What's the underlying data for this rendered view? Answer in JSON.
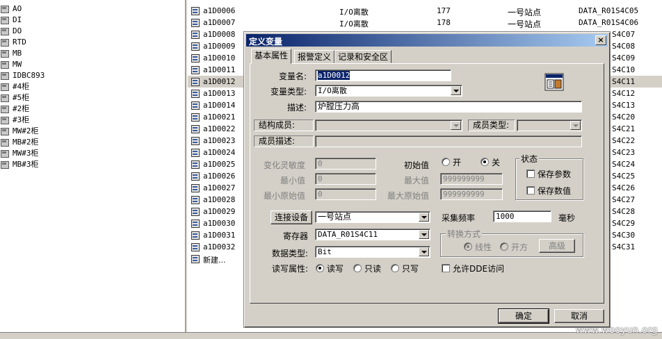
{
  "left_tree": {
    "items": [
      {
        "label": "AO"
      },
      {
        "label": "DI"
      },
      {
        "label": "DO"
      },
      {
        "label": "RTD"
      },
      {
        "label": "MB"
      },
      {
        "label": "MW"
      },
      {
        "label": "IDBC893"
      },
      {
        "label": "#4柜"
      },
      {
        "label": "#5柜"
      },
      {
        "label": "#2柜"
      },
      {
        "label": "#3柜"
      },
      {
        "label": "MW#2柜"
      },
      {
        "label": "MB#2柜"
      },
      {
        "label": "MW#3柜"
      },
      {
        "label": "MB#3柜"
      }
    ]
  },
  "var_list": {
    "rows": [
      {
        "name": "a1D0006",
        "type": "I/O离散",
        "id": "177",
        "station": "一号站点",
        "reg": "DATA_R01S4C05",
        "reg_tail": ""
      },
      {
        "name": "a1D0007",
        "type": "I/O离散",
        "id": "178",
        "station": "一号站点",
        "reg": "DATA_R01S4C06",
        "reg_tail": ""
      },
      {
        "name": "a1D0008",
        "type": "",
        "id": "",
        "station": "",
        "reg": "",
        "reg_tail": "S4C07"
      },
      {
        "name": "a1D0009",
        "type": "",
        "id": "",
        "station": "",
        "reg": "",
        "reg_tail": "S4C08"
      },
      {
        "name": "a1D0010",
        "type": "",
        "id": "",
        "station": "",
        "reg": "",
        "reg_tail": "S4C09"
      },
      {
        "name": "a1D0011",
        "type": "",
        "id": "",
        "station": "",
        "reg": "",
        "reg_tail": "S4C10"
      },
      {
        "name": "a1D0012",
        "type": "",
        "id": "",
        "station": "",
        "reg": "",
        "reg_tail": "S4C11"
      },
      {
        "name": "a1D0013",
        "type": "",
        "id": "",
        "station": "",
        "reg": "",
        "reg_tail": "S4C12"
      },
      {
        "name": "a1D0014",
        "type": "",
        "id": "",
        "station": "",
        "reg": "",
        "reg_tail": "S4C13"
      },
      {
        "name": "a1D0021",
        "type": "",
        "id": "",
        "station": "",
        "reg": "",
        "reg_tail": "S4C20"
      },
      {
        "name": "a1D0022",
        "type": "",
        "id": "",
        "station": "",
        "reg": "",
        "reg_tail": "S4C21"
      },
      {
        "name": "a1D0023",
        "type": "",
        "id": "",
        "station": "",
        "reg": "",
        "reg_tail": "S4C22"
      },
      {
        "name": "a1D0024",
        "type": "",
        "id": "",
        "station": "",
        "reg": "",
        "reg_tail": "S4C23"
      },
      {
        "name": "a1D0025",
        "type": "",
        "id": "",
        "station": "",
        "reg": "",
        "reg_tail": "S4C24"
      },
      {
        "name": "a1D0026",
        "type": "",
        "id": "",
        "station": "",
        "reg": "",
        "reg_tail": "S4C25"
      },
      {
        "name": "a1D0027",
        "type": "",
        "id": "",
        "station": "",
        "reg": "",
        "reg_tail": "S4C26"
      },
      {
        "name": "a1D0028",
        "type": "",
        "id": "",
        "station": "",
        "reg": "",
        "reg_tail": "S4C27"
      },
      {
        "name": "a1D0029",
        "type": "",
        "id": "",
        "station": "",
        "reg": "",
        "reg_tail": "S4C28"
      },
      {
        "name": "a1D0030",
        "type": "",
        "id": "",
        "station": "",
        "reg": "",
        "reg_tail": "S4C29"
      },
      {
        "name": "a1D0031",
        "type": "",
        "id": "",
        "station": "",
        "reg": "",
        "reg_tail": "S4C30"
      },
      {
        "name": "a1D0032",
        "type": "",
        "id": "",
        "station": "",
        "reg": "",
        "reg_tail": "S4C31"
      }
    ],
    "new_item": "新建..."
  },
  "dialog": {
    "title": "定义变量",
    "close_glyph": "×",
    "tabs": [
      {
        "label": "基本属性"
      },
      {
        "label": "报警定义"
      },
      {
        "label": "记录和安全区"
      }
    ],
    "var_name": {
      "label": "变量名:",
      "value": "a1D0012"
    },
    "var_type": {
      "label": "变量类型:",
      "value": "I/O离散"
    },
    "description": {
      "label": "描述:",
      "value": "炉膛压力高"
    },
    "struct_member": {
      "label": "结构成员:",
      "value": ""
    },
    "member_type": {
      "label": "成员类型:",
      "value": ""
    },
    "member_desc": {
      "label": "成员描述:",
      "value": ""
    },
    "sensitivity": {
      "label": "变化灵敏度",
      "value": "0"
    },
    "min_value": {
      "label": "最小值",
      "value": "0"
    },
    "min_raw": {
      "label": "最小原始值",
      "value": "0"
    },
    "max_value": {
      "label": "最大值",
      "value": "999999999"
    },
    "max_raw": {
      "label": "最大原始值",
      "value": "999999999"
    },
    "initial": {
      "label": "初始值",
      "on_label": "开",
      "off_label": "关",
      "selected": "off"
    },
    "status_group": {
      "title": "状态",
      "save_params": "保存参数",
      "save_values": "保存数值"
    },
    "device_button": "连接设备",
    "device": {
      "value": "一号站点"
    },
    "frequency": {
      "label": "采集频率",
      "value": "1000",
      "unit": "毫秒"
    },
    "register": {
      "label": "寄存器",
      "value": "DATA_R01S4C11"
    },
    "conversion": {
      "title": "转换方式",
      "linear": "线性",
      "sqrt": "开方",
      "advanced": "高级"
    },
    "data_type": {
      "label": "数据类型:",
      "value": "Bit"
    },
    "rw": {
      "label": "读写属性:",
      "rw": "读写",
      "ro": "只读",
      "wo": "只写",
      "selected": "rw"
    },
    "dde": {
      "label": "允许DDE访问"
    },
    "ok": "确定",
    "cancel": "取消"
  },
  "watermark": "www.wooyun.org"
}
